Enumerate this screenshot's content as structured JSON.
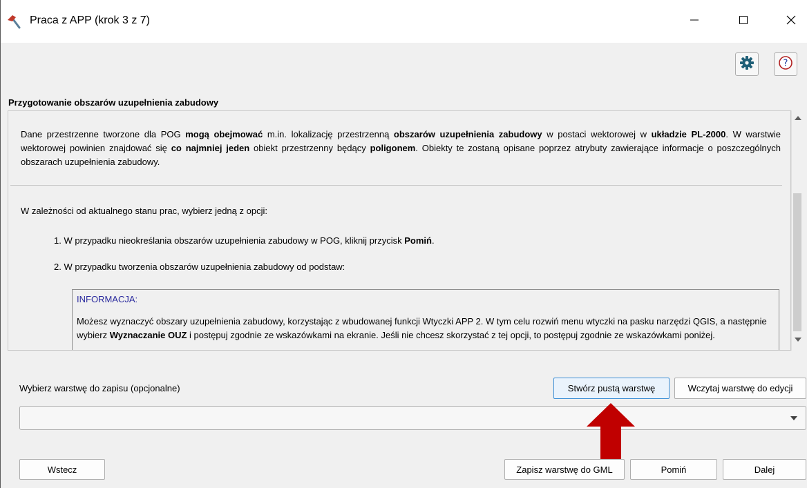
{
  "window": {
    "title": "Praca z APP (krok 3 z 7)",
    "app_icon": "hammer-icon"
  },
  "toolbar": {
    "settings_icon": "gear-icon",
    "help_icon": "help-icon",
    "accent_color": "#1f5f77"
  },
  "section": {
    "title": "Przygotowanie obszarów uzupełnienia zabudowy"
  },
  "content": {
    "intro": {
      "p1": "Dane przestrzenne tworzone dla POG ",
      "b1": "mogą obejmować",
      "p2": " m.in. lokalizację przestrzenną ",
      "b2": "obszarów uzupełnienia zabudowy",
      "p3": " w postaci wektorowej w ",
      "b3": "układzie PL-2000",
      "p4": ". W warstwie wektorowej powinien znajdować się ",
      "b4": "co najmniej jeden",
      "p5": " obiekt przestrzenny będący ",
      "b5": "poligonem",
      "p6": ". Obiekty te zostaną opisane poprzez atrybuty zawierające informacje o poszczególnych obszarach uzupełnienia zabudowy."
    },
    "choose_option": "W zależności od aktualnego stanu prac, wybierz jedną z opcji:",
    "step1": {
      "text": "1. W przypadku nieokreślania obszarów uzupełnienia zabudowy w POG, kliknij przycisk ",
      "bold": "Pomiń",
      "end": "."
    },
    "step2": {
      "text": "2. W przypadku tworzenia obszarów uzupełnienia zabudowy od podstaw:"
    },
    "info": {
      "heading": "INFORMACJA:",
      "p1": "Możesz wyznaczyć obszary uzupełnienia zabudowy, korzystając z wbudowanej funkcji Wtyczki APP 2. W tym celu rozwiń menu wtyczki na pasku narzędzi QGIS, a następnie wybierz ",
      "bold": "Wyznaczanie OUZ",
      "p2": " i postępuj zgodnie ze wskazówkami na ekranie. Jeśli nie chcesz skorzystać z tej opcji, to postępuj zgodnie ze wskazówkami poniżej."
    }
  },
  "layer": {
    "label": "Wybierz warstwę do zapisu (opcjonalne)",
    "create_button": "Stwórz pustą warstwę",
    "load_button": "Wczytaj warstwę do edycji",
    "selected_value": ""
  },
  "annotation": {
    "arrow_color": "#c00000"
  },
  "footer": {
    "back": "Wstecz",
    "save_gml": "Zapisz warstwę do GML",
    "skip": "Pomiń",
    "next": "Dalej"
  }
}
